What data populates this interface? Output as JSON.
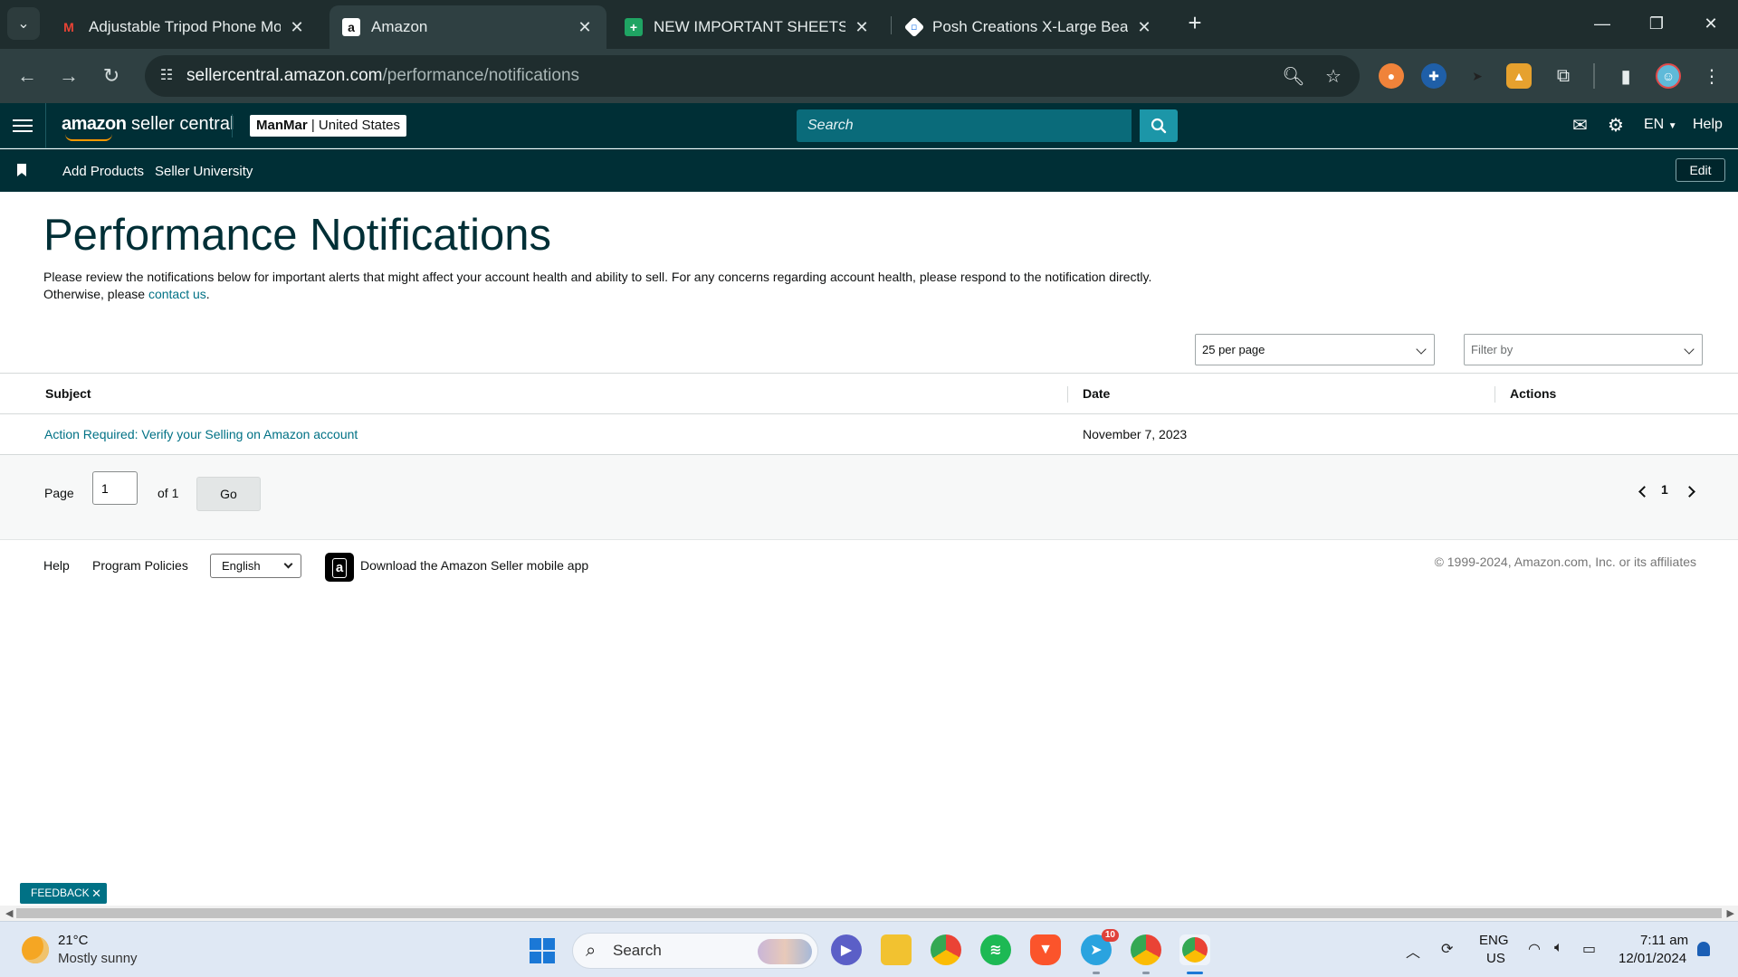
{
  "browser": {
    "tabs": [
      {
        "title": "Adjustable Tripod Phone Mount",
        "icon": "gmail-icon",
        "active": false
      },
      {
        "title": "Amazon",
        "icon": "amazon-icon",
        "active": true
      },
      {
        "title": "NEW IMPORTANT SHEETS | Cyr",
        "icon": "sheets-icon",
        "active": false
      },
      {
        "title": "Posh Creations X-Large Bean Ba",
        "icon": "diamond-icon",
        "active": false
      }
    ],
    "url_domain": "sellercentral.amazon.com",
    "url_path": "/performance/notifications"
  },
  "header": {
    "logo_amazon": "amazon",
    "logo_rest": " seller central",
    "merchant": "ManMar",
    "marketplace": "United States",
    "search_placeholder": "Search",
    "language": "EN",
    "help": "Help"
  },
  "subnav": {
    "links": [
      "Add Products",
      "Seller University"
    ],
    "edit": "Edit"
  },
  "page": {
    "title": "Performance Notifications",
    "intro_line1": "Please review the notifications below for important alerts that might affect your account health and ability to sell. For any concerns regarding account health, please respond to the notification directly.",
    "intro_line2_prefix": "Otherwise, please ",
    "intro_link": "contact us",
    "intro_suffix": ".",
    "per_page": "25 per page",
    "filter_placeholder": "Filter by"
  },
  "table": {
    "columns": [
      "Subject",
      "Date",
      "Actions"
    ],
    "rows": [
      {
        "subject": "Action Required: Verify your Selling on Amazon account",
        "date": "November 7, 2023",
        "actions": ""
      }
    ]
  },
  "pager": {
    "page_label": "Page",
    "page_value": "1",
    "of_label": "of 1",
    "go": "Go",
    "current": "1"
  },
  "footer": {
    "help": "Help",
    "policies": "Program Policies",
    "language": "English",
    "app_text": "Download the Amazon Seller mobile app",
    "copyright": "© 1999-2024, Amazon.com, Inc. or its affiliates"
  },
  "feedback": "FEEDBACK",
  "taskbar": {
    "temp": "21°C",
    "weather": "Mostly sunny",
    "search": "Search",
    "telegram_badge": "10",
    "lang1": "ENG",
    "lang2": "US",
    "time": "7:11 am",
    "date": "12/01/2024"
  },
  "colors": {
    "header_bg": "#002f36",
    "link": "#007185",
    "search_btn": "#1c96a8"
  }
}
